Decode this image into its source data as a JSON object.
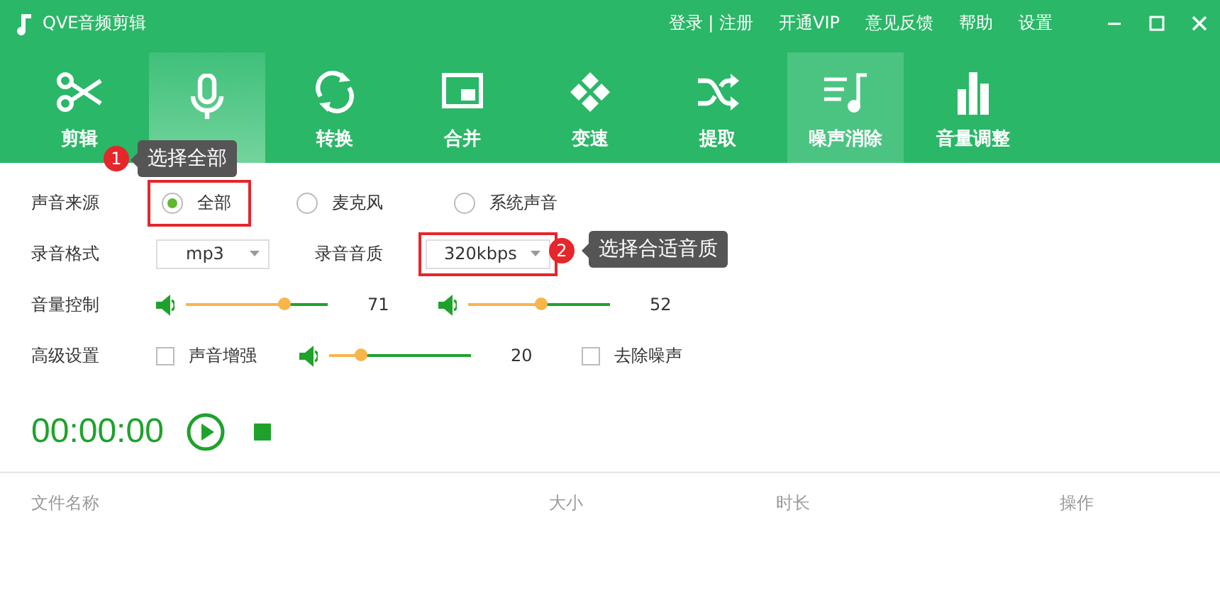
{
  "window": {
    "title": "QVE音频剪辑",
    "links": [
      "登录 | 注册",
      "开通VIP",
      "意见反馈",
      "帮助",
      "设置"
    ]
  },
  "tabs": [
    {
      "label": "剪辑",
      "selected": false,
      "hovered": false
    },
    {
      "selected": true,
      "hovered": false
    },
    {
      "label": "转换",
      "selected": false,
      "hovered": false
    },
    {
      "label": "合并",
      "selected": false,
      "hovered": false
    },
    {
      "label": "变速",
      "selected": false,
      "hovered": false
    },
    {
      "label": "提取",
      "selected": false,
      "hovered": false
    },
    {
      "label": "噪声消除",
      "selected": false,
      "hovered": true
    },
    {
      "label": "音量调整",
      "selected": false,
      "hovered": false
    }
  ],
  "settings": {
    "source": {
      "label": "声音来源",
      "options": [
        {
          "label": "全部",
          "selected": true,
          "highlighted": true
        },
        {
          "label": "麦克风",
          "selected": false,
          "highlighted": false
        },
        {
          "label": "系统声音",
          "selected": false,
          "highlighted": false
        }
      ]
    },
    "format": {
      "label": "录音格式",
      "value": "mp3",
      "quality_label": "录音音质",
      "quality_value": "320kbps",
      "quality_highlighted": true
    },
    "volume": {
      "label": "音量控制",
      "sliders": [
        {
          "level": 0.69,
          "reading": "71"
        },
        {
          "level": 0.51,
          "reading": "52"
        }
      ]
    },
    "advanced": {
      "label": "高级设置",
      "enhance": {
        "label": "声音增强",
        "checked": false
      },
      "slider": {
        "level": 0.22,
        "reading": "20"
      },
      "denoise": {
        "label": "去除噪声",
        "checked": false
      }
    }
  },
  "timer": "00:00:00",
  "table": {
    "columns": [
      "文件名称",
      "大小",
      "时长",
      "操作"
    ]
  },
  "annotations": [
    {
      "number": "1",
      "text": "选择全部"
    },
    {
      "number": "2",
      "text": "选择合适音质"
    }
  ]
}
